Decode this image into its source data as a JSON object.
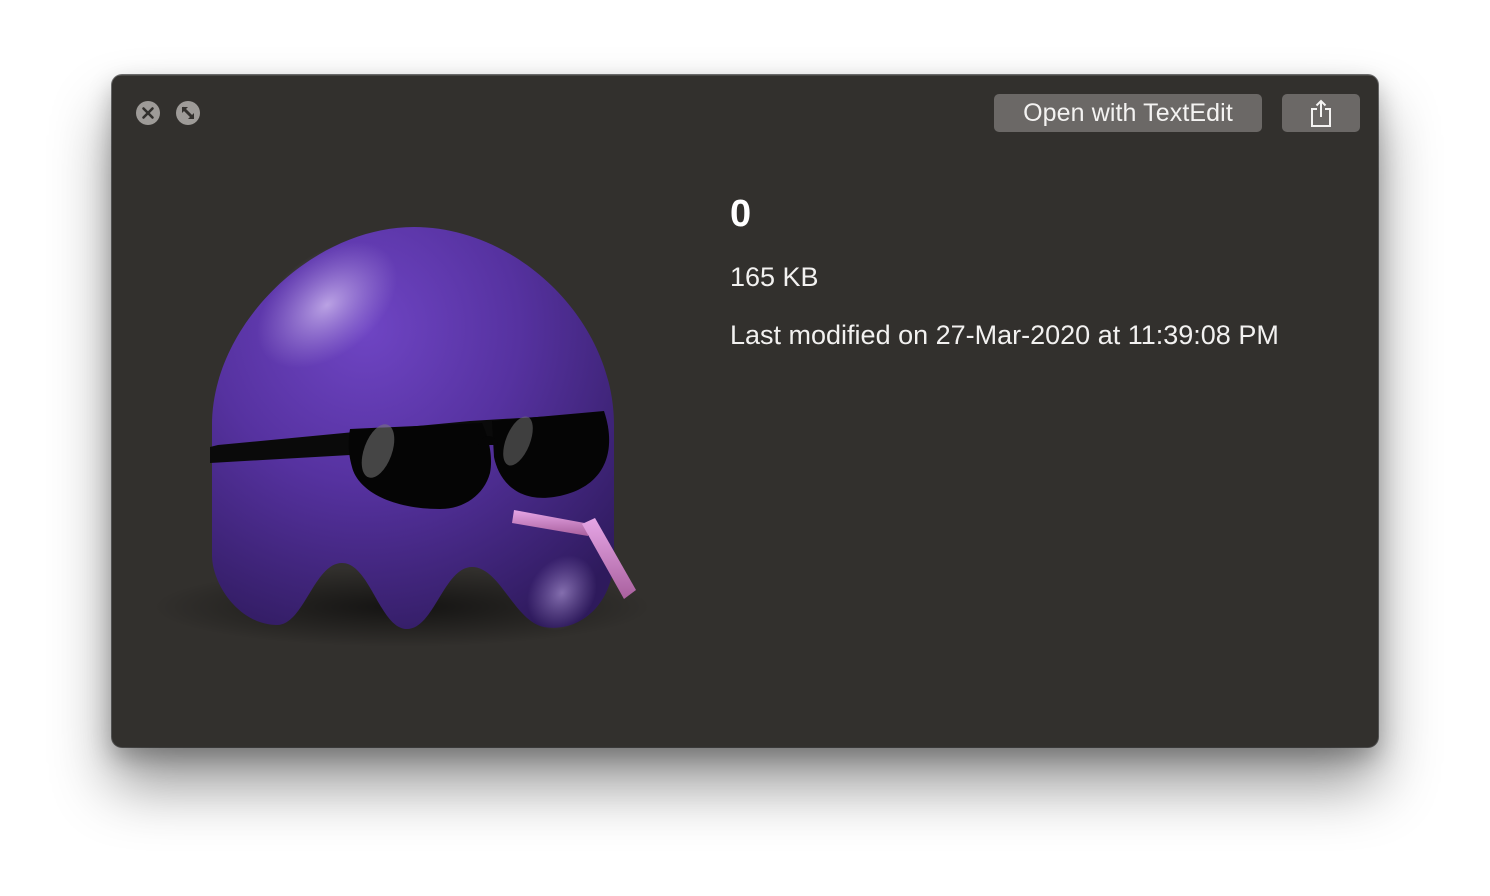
{
  "toolbar": {
    "open_with_label": "Open with TextEdit"
  },
  "file": {
    "name": "0",
    "size": "165 KB",
    "modified": "Last modified on 27-Mar-2020 at 11:39:08 PM"
  },
  "icons": {
    "close": "close-icon",
    "fullscreen": "fullscreen-icon",
    "share": "share-icon",
    "preview": "purple-ghost-with-sunglasses"
  },
  "colors": {
    "window_background": "#32302d",
    "button_background": "#6b6866",
    "ghost_purple": "#5a34a3",
    "text": "#f2f1f0"
  }
}
